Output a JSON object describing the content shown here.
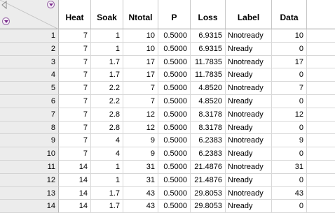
{
  "table": {
    "columns": [
      "Heat",
      "Soak",
      "Ntotal",
      "P",
      "Loss",
      "Label",
      "Data"
    ],
    "rows": [
      {
        "n": "1",
        "Heat": "7",
        "Soak": "1",
        "Ntotal": "10",
        "P": "0.5000",
        "Loss": "6.9315",
        "Label": "Nnotready",
        "Data": "10"
      },
      {
        "n": "2",
        "Heat": "7",
        "Soak": "1",
        "Ntotal": "10",
        "P": "0.5000",
        "Loss": "6.9315",
        "Label": "Nready",
        "Data": "0"
      },
      {
        "n": "3",
        "Heat": "7",
        "Soak": "1.7",
        "Ntotal": "17",
        "P": "0.5000",
        "Loss": "11.7835",
        "Label": "Nnotready",
        "Data": "17"
      },
      {
        "n": "4",
        "Heat": "7",
        "Soak": "1.7",
        "Ntotal": "17",
        "P": "0.5000",
        "Loss": "11.7835",
        "Label": "Nready",
        "Data": "0"
      },
      {
        "n": "5",
        "Heat": "7",
        "Soak": "2.2",
        "Ntotal": "7",
        "P": "0.5000",
        "Loss": "4.8520",
        "Label": "Nnotready",
        "Data": "7"
      },
      {
        "n": "6",
        "Heat": "7",
        "Soak": "2.2",
        "Ntotal": "7",
        "P": "0.5000",
        "Loss": "4.8520",
        "Label": "Nready",
        "Data": "0"
      },
      {
        "n": "7",
        "Heat": "7",
        "Soak": "2.8",
        "Ntotal": "12",
        "P": "0.5000",
        "Loss": "8.3178",
        "Label": "Nnotready",
        "Data": "12"
      },
      {
        "n": "8",
        "Heat": "7",
        "Soak": "2.8",
        "Ntotal": "12",
        "P": "0.5000",
        "Loss": "8.3178",
        "Label": "Nready",
        "Data": "0"
      },
      {
        "n": "9",
        "Heat": "7",
        "Soak": "4",
        "Ntotal": "9",
        "P": "0.5000",
        "Loss": "6.2383",
        "Label": "Nnotready",
        "Data": "9"
      },
      {
        "n": "10",
        "Heat": "7",
        "Soak": "4",
        "Ntotal": "9",
        "P": "0.5000",
        "Loss": "6.2383",
        "Label": "Nready",
        "Data": "0"
      },
      {
        "n": "11",
        "Heat": "14",
        "Soak": "1",
        "Ntotal": "31",
        "P": "0.5000",
        "Loss": "21.4876",
        "Label": "Nnotready",
        "Data": "31"
      },
      {
        "n": "12",
        "Heat": "14",
        "Soak": "1",
        "Ntotal": "31",
        "P": "0.5000",
        "Loss": "21.4876",
        "Label": "Nready",
        "Data": "0"
      },
      {
        "n": "13",
        "Heat": "14",
        "Soak": "1.7",
        "Ntotal": "43",
        "P": "0.5000",
        "Loss": "29.8053",
        "Label": "Nnotready",
        "Data": "43"
      },
      {
        "n": "14",
        "Heat": "14",
        "Soak": "1.7",
        "Ntotal": "43",
        "P": "0.5000",
        "Loss": "29.8053",
        "Label": "Nready",
        "Data": "0"
      }
    ]
  },
  "icons": {
    "column_menu": "red-triangle-menu-icon",
    "row_menu": "red-triangle-menu-icon",
    "accent": "#7b2c8c"
  }
}
